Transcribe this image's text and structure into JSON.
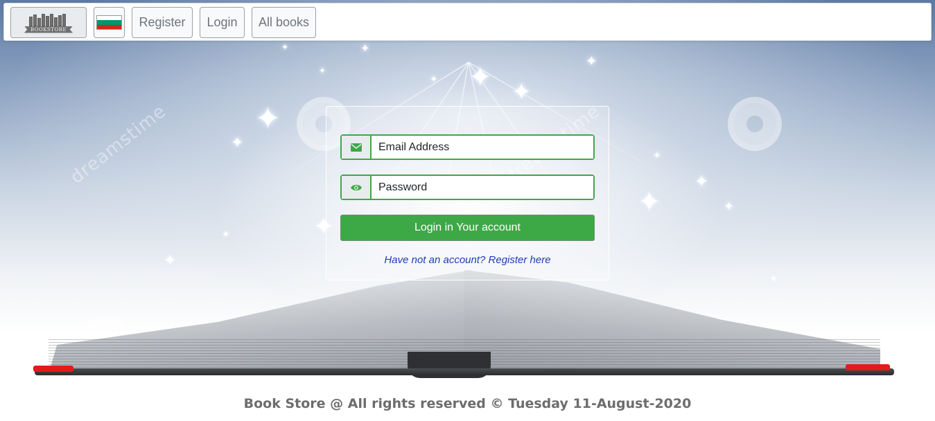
{
  "navbar": {
    "logo_text": "BOOKSTORE",
    "language_flag": {
      "icon": "bulgarian-flag-icon",
      "colors": [
        "#ffffff",
        "#00966e",
        "#d62612"
      ]
    },
    "register_label": "Register",
    "login_label": "Login",
    "all_books_label": "All books"
  },
  "login_form": {
    "email_placeholder": "Email Address",
    "email_icon": "envelope-icon",
    "password_placeholder": "Password",
    "password_icon": "eye-icon",
    "submit_label": "Login in Your account",
    "register_link": "Have not an account? Register here"
  },
  "background": {
    "watermark_text": "dreamstime"
  },
  "footer": {
    "text": "Book Store @ All rights reserved © Tuesday 11-August-2020"
  },
  "colors": {
    "accent": "#3da846",
    "link": "#1f3bb3",
    "footer_text": "#6c6c6c"
  }
}
